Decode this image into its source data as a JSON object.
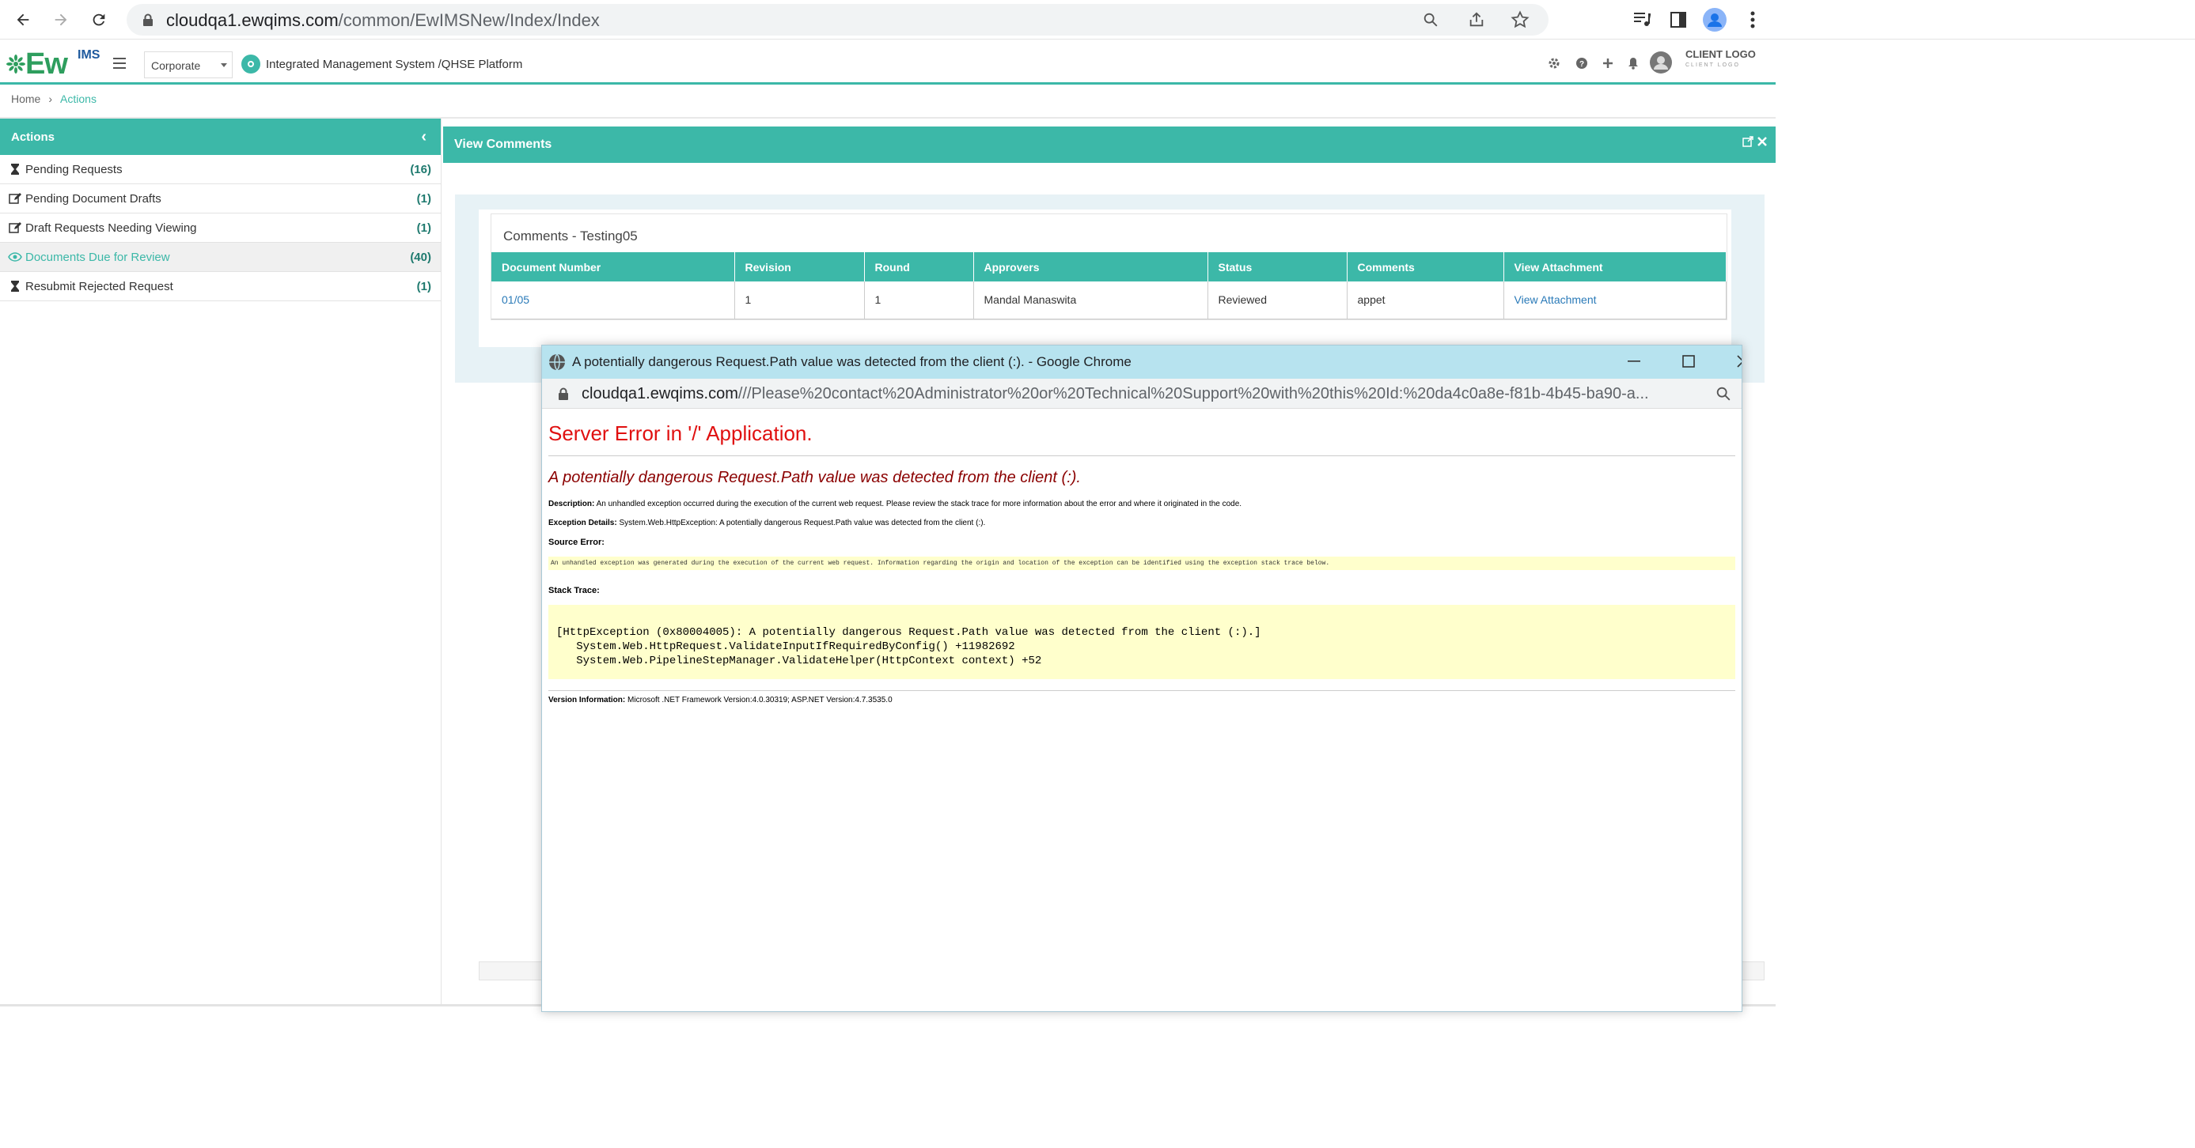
{
  "browser": {
    "url_host": "cloudqa1.ewqims.com",
    "url_path": "/common/EwIMSNew/Index/Index"
  },
  "header": {
    "logo_text": "Ew",
    "logo_sub": "IMS",
    "company": "Corporate",
    "system_title": "Integrated Management System /QHSE Platform",
    "client_logo": "CLIENT LOGO",
    "client_logo_sub": "CLIENT LOGO"
  },
  "breadcrumb": {
    "home": "Home",
    "separator": "›",
    "current": "Actions"
  },
  "sidebar": {
    "title": "Actions",
    "items": [
      {
        "label": "Pending Requests",
        "count": "(16)",
        "icon": "hourglass-icon"
      },
      {
        "label": "Pending Document Drafts",
        "count": "(1)",
        "icon": "edit-icon"
      },
      {
        "label": "Draft Requests Needing Viewing",
        "count": "(1)",
        "icon": "edit-icon"
      },
      {
        "label": "Documents Due for Review",
        "count": "(40)",
        "icon": "eye-icon"
      },
      {
        "label": "Resubmit Rejected Request",
        "count": "(1)",
        "icon": "hourglass-icon"
      }
    ]
  },
  "main": {
    "title": "View Comments",
    "comments_title": "Comments - Testing05",
    "columns": [
      "Document Number",
      "Revision",
      "Round",
      "Approvers",
      "Status",
      "Comments",
      "View Attachment"
    ],
    "rows": [
      [
        "01/05",
        "1",
        "1",
        "Mandal Manaswita",
        "Reviewed",
        "appet",
        "View Attachment"
      ]
    ]
  },
  "popup": {
    "title": "A potentially dangerous Request.Path value was detected from the client (:). - Google Chrome",
    "url_host": "cloudqa1.ewqims.com",
    "url_path": "///Please%20contact%20Administrator%20or%20Technical%20Support%20with%20this%20Id:%20da4c0a8e-f81b-4b45-ba90-a...",
    "error_title": "Server Error in '/' Application.",
    "error_sub": "A potentially dangerous Request.Path value was detected from the client (:).",
    "description_label": "Description:",
    "description": "An unhandled exception occurred during the execution of the current web request. Please review the stack trace for more information about the error and where it originated in the code.",
    "exception_label": "Exception Details:",
    "exception": "System.Web.HttpException: A potentially dangerous Request.Path value was detected from the client (:).",
    "source_label": "Source Error:",
    "source": "An unhandled exception was generated during the execution of the current web request. Information regarding the origin and location of the exception can be identified using the exception stack trace below.",
    "stack_label": "Stack Trace:",
    "stack": "[HttpException (0x80004005): A potentially dangerous Request.Path value was detected from the client (:).]\n   System.Web.HttpRequest.ValidateInputIfRequiredByConfig() +11982692\n   System.Web.PipelineStepManager.ValidateHelper(HttpContext context) +52",
    "version_label": "Version Information:",
    "version": "Microsoft .NET Framework Version:4.0.30319; ASP.NET Version:4.7.3535.0"
  },
  "colors": {
    "accent": "#3cb8a8",
    "error_red": "#e01010",
    "error_dark": "#8b0000"
  }
}
